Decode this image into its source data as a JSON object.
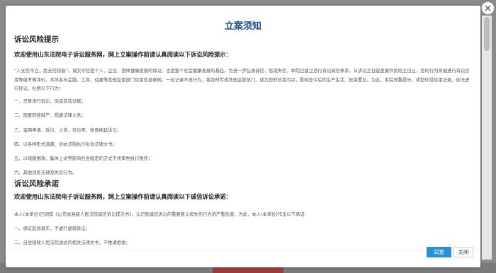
{
  "modal": {
    "title": "立案须知",
    "close_icon": "×"
  },
  "risk_warning": {
    "heading": "诉讼风险提示",
    "lead": "欢迎使用山东法院电子诉讼服务网，网上立案操作前请认真阅读以下诉讼风险提示：",
    "paragraph": "“人无信不立，民无信则衰”。诚实守信是个人、企业、团体健康发展的保证，也是整个社会健康发展的基石。为进一步弘扬诚信、惩戒失信，本院已建立违行诉讼诚信体系，从诉讼之日起至案件执结之日止，您的行为将被进行诉讼信用等级考察评价。本体系与金融、工商、住建等其他监管部门信用信息联网，一旦记录不良行为，将及时传递其他监管部门，成为您的信用污点，影响您今后的生产生活、投资置业。为此，本院郑重提示，请您珍惜信用记录，依法进行诉讼，杜绝以下行为：",
    "items": [
      "一、恶意进行诉讼，伪造变造证据；",
      "二、隐匿转移财产，规避法律义务；",
      "三、滥用申请、诉讼、上诉、信访等，故意拖延诉讼；",
      "四、以各种形式逃避、对抗法院执行生效法律文书；",
      "五、以堵路围攻、集体上访等影响社会稳定的方式干扰审判执行秩序；",
      "六、其他违反法律及失信行为。"
    ]
  },
  "pledge": {
    "heading": "诉讼风险承诺",
    "lead": "欢迎使用山东法院电子诉讼服务网，网上立案操作前请认真阅读以下诚信诉讼承诺：",
    "paragraph": "本人(本单位)已阅知《山东省高级人民法院诚信诉讼提示书》，认识到诚信诉讼的重要意义和失信行为的严重危害，为此，本人(本单位)作出以下承诺：",
    "items": [
      "一、保证起诉真实，不虚打虚假诉讼；",
      "二、自觉接收人民法院送达的相关法律文书，不推诿拒收；"
    ]
  },
  "footer": {
    "agree_label": "同意",
    "close_label": "关闭"
  },
  "colors": {
    "title": "#1b4f8a",
    "agree_button": "#2a8fd6"
  }
}
